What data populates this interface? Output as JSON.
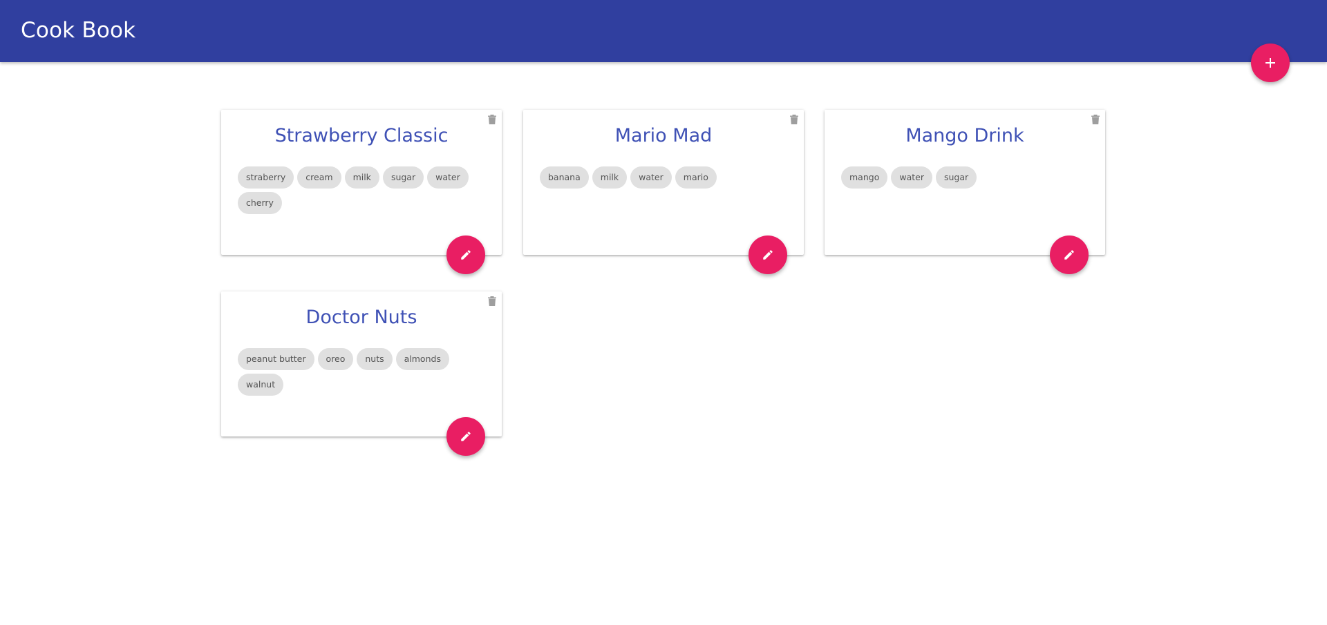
{
  "app": {
    "title": "Cook Book"
  },
  "colors": {
    "app_bar": "#303f9f",
    "accent": "#e91e63",
    "title_text": "#3f51b5",
    "chip_bg": "#e0e0e0"
  },
  "icons": {
    "add": "plus-icon",
    "edit": "pencil-icon",
    "delete": "trash-icon"
  },
  "recipes": [
    {
      "title": "Strawberry Classic",
      "ingredients": [
        "straberry",
        "cream",
        "milk",
        "sugar",
        "water",
        "cherry"
      ]
    },
    {
      "title": "Mario Mad",
      "ingredients": [
        "banana",
        "milk",
        "water",
        "mario"
      ]
    },
    {
      "title": "Mango Drink",
      "ingredients": [
        "mango",
        "water",
        "sugar"
      ]
    },
    {
      "title": "Doctor Nuts",
      "ingredients": [
        "peanut butter",
        "oreo",
        "nuts",
        "almonds",
        "walnut"
      ]
    }
  ]
}
